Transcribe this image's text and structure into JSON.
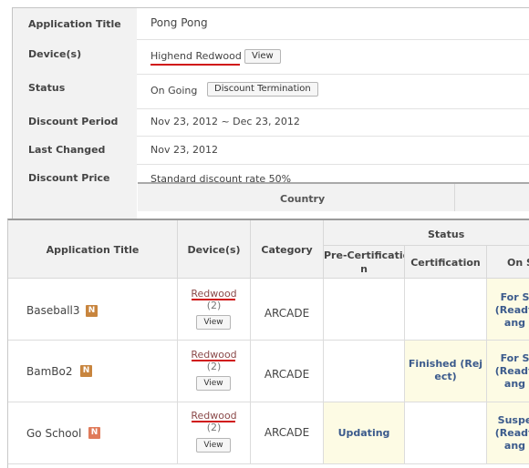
{
  "detail": {
    "app_title": {
      "label": "Application Title",
      "value": "Pong Pong"
    },
    "devices": {
      "label": "Device(s)",
      "value": "Highend Redwood",
      "button": "View"
    },
    "status": {
      "label": "Status",
      "value": "On Going",
      "button": "Discount Termination"
    },
    "period": {
      "label": "Discount Period",
      "value": "Nov 23, 2012 ~ Dec 23, 2012"
    },
    "last_changed": {
      "label": "Last Changed",
      "value": "Nov 23, 2012"
    },
    "price": {
      "label": "Discount Price",
      "value": "Standard discount rate 50%"
    },
    "country_header": "Country"
  },
  "table": {
    "headers": {
      "app_title": "Application Title",
      "devices": "Device(s)",
      "category": "Category",
      "status": "Status",
      "pre_cert_1": "Pre-Certificatio",
      "pre_cert_2": "n",
      "certification": "Certification",
      "on_sale": "On S"
    },
    "badge": "N",
    "view_label": "View",
    "rows": [
      {
        "name": "Baseball3",
        "device": "Redwood",
        "count": "(2)",
        "category": "ARCADE",
        "pre_cert": "",
        "cert": "",
        "sale": [
          "For S",
          "(Ready",
          "ang"
        ]
      },
      {
        "name": "BamBo2",
        "device": "Redwood",
        "count": "(2)",
        "category": "ARCADE",
        "pre_cert": "",
        "cert_1": "Finished (Rej",
        "cert_2": "ect)",
        "sale": [
          "For S",
          "(Ready",
          "ang"
        ]
      },
      {
        "name": "Go School",
        "device": "Redwood",
        "count": "(2)",
        "category": "ARCADE",
        "pre_cert": "Updating",
        "cert": "",
        "sale": [
          "Suspe",
          "(Ready",
          "ang"
        ]
      }
    ]
  }
}
